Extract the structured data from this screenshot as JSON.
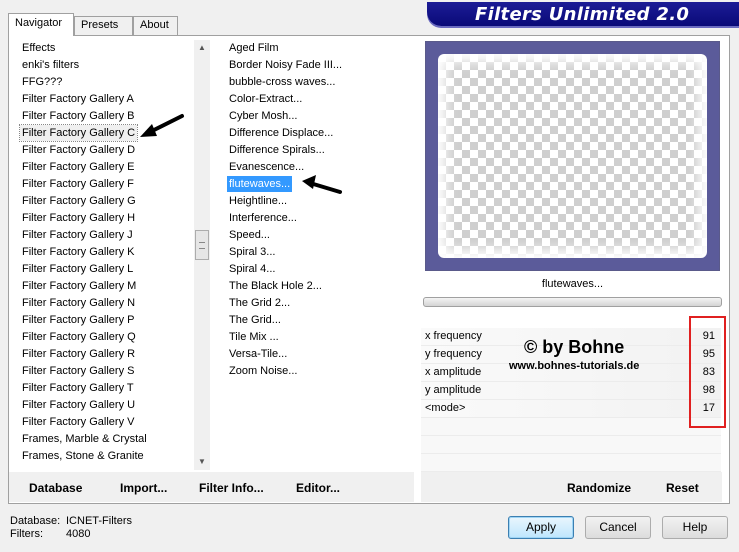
{
  "window": {
    "banner_title": "Filters Unlimited 2.0"
  },
  "tabs": [
    {
      "label": "Navigator",
      "active": true
    },
    {
      "label": "Presets",
      "active": false
    },
    {
      "label": "About",
      "active": false
    }
  ],
  "categories": [
    "Effects",
    "enki's filters",
    "FFG???",
    "Filter Factory Gallery A",
    "Filter Factory Gallery B",
    "Filter Factory Gallery C",
    "Filter Factory Gallery D",
    "Filter Factory Gallery E",
    "Filter Factory Gallery F",
    "Filter Factory Gallery G",
    "Filter Factory Gallery H",
    "Filter Factory Gallery J",
    "Filter Factory Gallery K",
    "Filter Factory Gallery L",
    "Filter Factory Gallery M",
    "Filter Factory Gallery N",
    "Filter Factory Gallery P",
    "Filter Factory Gallery Q",
    "Filter Factory Gallery R",
    "Filter Factory Gallery S",
    "Filter Factory Gallery T",
    "Filter Factory Gallery U",
    "Filter Factory Gallery V",
    "Frames, Marble & Crystal",
    "Frames, Stone & Granite"
  ],
  "selected_category": "Filter Factory Gallery C",
  "filters": [
    "Aged Film",
    "Border Noisy Fade III...",
    "bubble-cross waves...",
    "Color-Extract...",
    "Cyber Mosh...",
    "Difference Displace...",
    "Difference Spirals...",
    "Evanescence...",
    "flutewaves...",
    "Heightline...",
    "Interference...",
    "Speed...",
    "Spiral 3...",
    "Spiral 4...",
    "The Black Hole 2...",
    "The Grid 2...",
    "The Grid...",
    "Tile Mix ...",
    "Versa-Tile...",
    "Zoom Noise..."
  ],
  "selected_filter": "flutewaves...",
  "preview": {
    "label": "flutewaves..."
  },
  "parameters": [
    {
      "label": "x frequency",
      "value": "91"
    },
    {
      "label": "y frequency",
      "value": "95"
    },
    {
      "label": "x amplitude",
      "value": "83"
    },
    {
      "label": "y amplitude",
      "value": "98"
    },
    {
      "label": "<mode>",
      "value": "17"
    }
  ],
  "watermark": {
    "line1": "© by Bohne",
    "line2": "www.bohnes-tutorials.de"
  },
  "toolbar": {
    "database_label": "Database",
    "import_label": "Import...",
    "filter_info_label": "Filter Info...",
    "editor_label": "Editor...",
    "randomize_label": "Randomize",
    "reset_label": "Reset"
  },
  "status": {
    "database_key": "Database:",
    "database_value": "ICNET-Filters",
    "filters_key": "Filters:",
    "filters_value": "4080"
  },
  "buttons": {
    "apply": "Apply",
    "cancel": "Cancel",
    "help": "Help"
  },
  "icons": {
    "scroll_up": "scroll-up-arrow-icon",
    "scroll_down": "scroll-down-arrow-icon",
    "pointer": "black-arrow-icon"
  },
  "colors": {
    "banner": "#0a0a78",
    "selection": "#3399ff",
    "highlight_box": "#e02020"
  }
}
